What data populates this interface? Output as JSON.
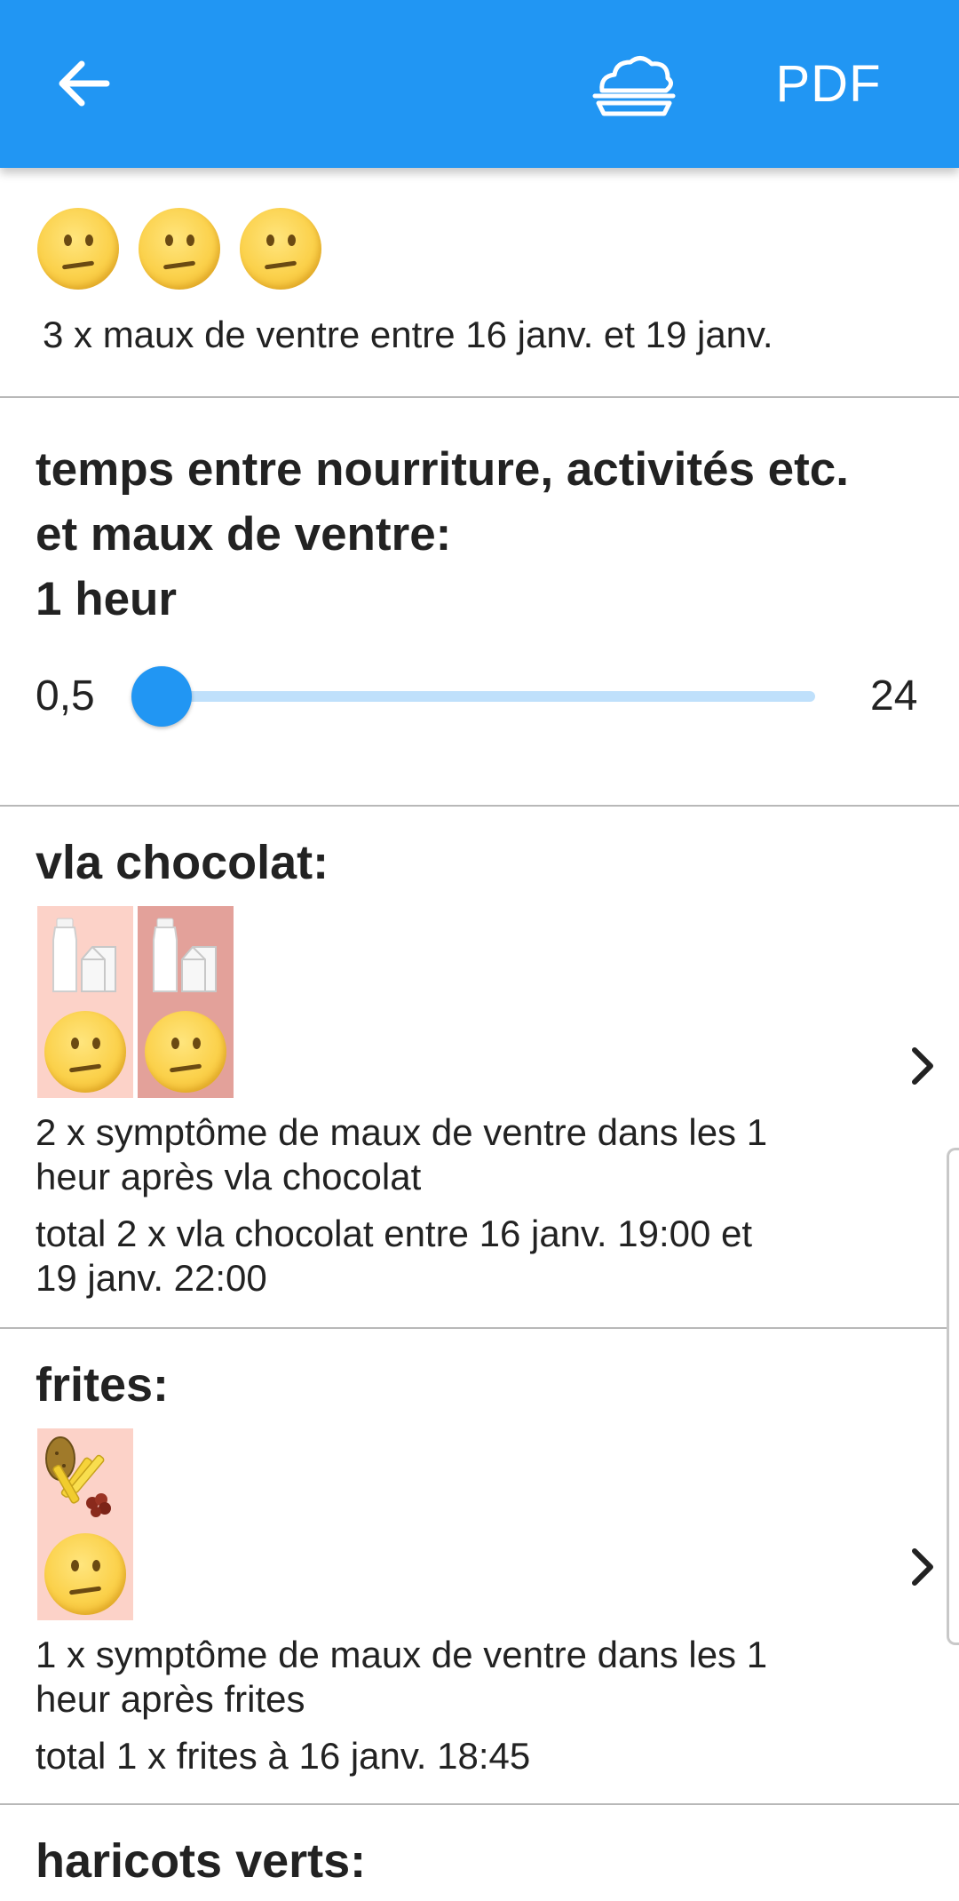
{
  "app_bar": {
    "back_icon": "arrow-left-icon",
    "dish_icon": "covered-dish-icon",
    "pdf_label": "PDF",
    "color": "#2196f3"
  },
  "summary": {
    "emoji_count": 3,
    "emoji_icon": "confused-face-icon",
    "text": "3 x maux de ventre entre 16 janv. et 19 janv."
  },
  "delay": {
    "title_line1": "temps entre nourriture, activités etc.",
    "title_line2": "et maux de ventre:",
    "title_line3": "1 heur",
    "slider": {
      "min_label": "0,5",
      "max_label": "24",
      "min": 0.5,
      "max": 24,
      "value": 1
    }
  },
  "foods": [
    {
      "title": "vla chocolat:",
      "tiles": [
        {
          "icon": "milk-carton-icon",
          "bg": "#fcd2c8"
        },
        {
          "icon": "milk-carton-icon",
          "bg": "#e3a19a"
        }
      ],
      "line1": "2 x symptôme de maux de ventre dans les 1",
      "line2": "heur après vla chocolat",
      "line3": "total 2 x vla chocolat entre 16 janv. 19:00 et",
      "line4": "19 janv. 22:00"
    },
    {
      "title": "frites:",
      "tiles": [
        {
          "icon": "fries-icon",
          "bg": "#fcd2c8"
        }
      ],
      "line1": "1 x symptôme de maux de ventre dans les 1",
      "line2": "heur après frites",
      "line3": "total 1 x frites à 16 janv. 18:45",
      "line4": ""
    },
    {
      "title": "haricots verts:"
    }
  ]
}
